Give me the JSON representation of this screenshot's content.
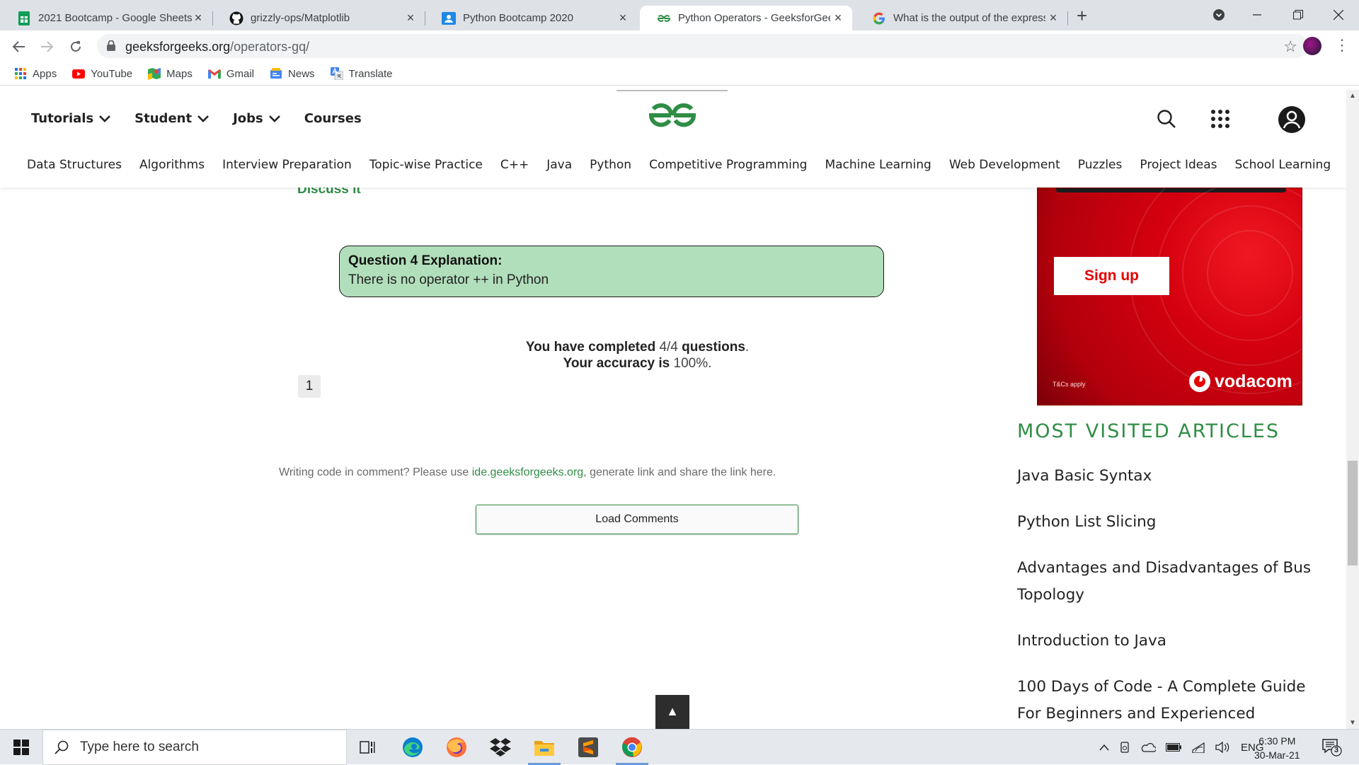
{
  "browser": {
    "tabs": [
      {
        "title": "2021 Bootcamp - Google Sheets",
        "icon": "google-sheets-icon",
        "active": false
      },
      {
        "title": "grizzly-ops/Matplotlib",
        "icon": "github-icon",
        "active": false
      },
      {
        "title": "Python Bootcamp 2020",
        "icon": "google-classroom-icon",
        "active": false
      },
      {
        "title": "Python Operators - GeeksforGeeks",
        "icon": "gfg-icon",
        "active": true
      },
      {
        "title": "What is the output of the expression",
        "icon": "google-icon",
        "active": false
      }
    ],
    "url_host": "geeksforgeeks.org",
    "url_path": "/operators-gq/",
    "bookmarks": [
      {
        "label": "Apps",
        "icon": "apps-grid-icon"
      },
      {
        "label": "YouTube",
        "icon": "youtube-icon"
      },
      {
        "label": "Maps",
        "icon": "maps-icon"
      },
      {
        "label": "Gmail",
        "icon": "gmail-icon"
      },
      {
        "label": "News",
        "icon": "news-icon"
      },
      {
        "label": "Translate",
        "icon": "translate-icon"
      }
    ]
  },
  "site": {
    "top_nav": [
      {
        "label": "Tutorials"
      },
      {
        "label": "Student"
      },
      {
        "label": "Jobs"
      },
      {
        "label": "Courses"
      }
    ],
    "sub_nav": [
      "Data Structures",
      "Algorithms",
      "Interview Preparation",
      "Topic-wise Practice",
      "C++",
      "Java",
      "Python",
      "Competitive Programming",
      "Machine Learning",
      "Web Development",
      "Puzzles",
      "Project Ideas",
      "School Learning"
    ],
    "brand_color": "#2f8d46"
  },
  "quiz": {
    "discuss_label": "Discuss it",
    "explanation_title": "Question 4 Explanation:",
    "explanation_body": "There is no operator ++ in Python",
    "completed_prefix": "You have completed",
    "completed_value": "4/4",
    "completed_suffix": "questions",
    "accuracy_prefix": "Your accuracy is",
    "accuracy_value": "100%",
    "page_number": "1"
  },
  "comments": {
    "note_prefix": "Writing code in comment? Please use",
    "note_link": "ide.geeksforgeeks.org",
    "note_suffix": ", generate link and share the link here.",
    "load_button": "Load Comments"
  },
  "ad": {
    "signup_label": "Sign up",
    "tcs": "T&Cs apply",
    "brand": "vodacom",
    "color": "#e60000"
  },
  "sidebar": {
    "title": "MOST VISITED ARTICLES",
    "articles": [
      "Java Basic Syntax",
      "Python List Slicing",
      "Advantages and Disadvantages of Bus Topology",
      "Introduction to Java",
      "100 Days of Code - A Complete Guide For Beginners and Experienced"
    ]
  },
  "back_to_top": "▲",
  "taskbar": {
    "search_placeholder": "Type here to search",
    "apps": [
      "task-view-icon",
      "edge-icon",
      "firefox-icon",
      "dropbox-icon",
      "file-explorer-icon",
      "sublime-text-icon",
      "chrome-icon"
    ],
    "language": "ENG",
    "time": "6:30 PM",
    "date": "30-Mar-21",
    "notification_count": "3"
  }
}
